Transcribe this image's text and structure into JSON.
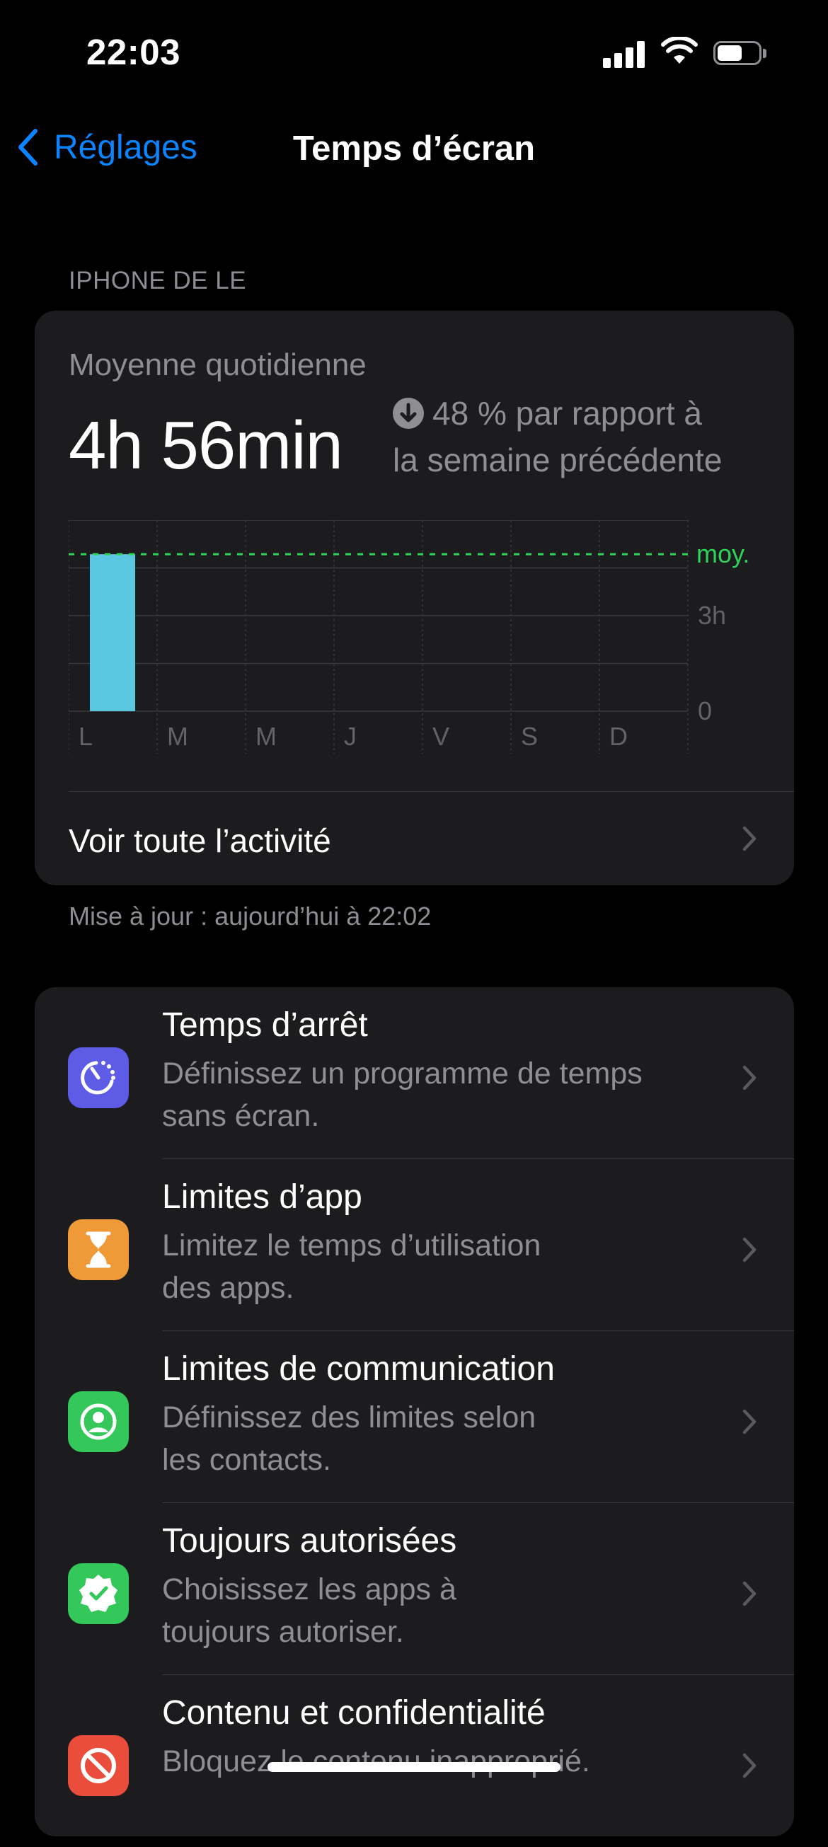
{
  "status": {
    "time": "22:03",
    "battery_level": 0.6
  },
  "nav": {
    "back_label": "Réglages",
    "title": "Temps d’écran"
  },
  "device_header": "IPHONE DE LE",
  "summary": {
    "avg_label": "Moyenne quotidienne",
    "avg_value": "4h 56min",
    "compare_line1": "48 % par rapport à",
    "compare_line2": "la semaine précédente",
    "see_all_label": "Voir toute l’activité"
  },
  "chart_data": {
    "type": "bar",
    "categories": [
      "L",
      "M",
      "M",
      "J",
      "V",
      "S",
      "D"
    ],
    "values": [
      4.93,
      0,
      0,
      0,
      0,
      0,
      0
    ],
    "average": 4.93,
    "average_label": "moy.",
    "y_ticks": [
      {
        "value": 0,
        "label": "0"
      },
      {
        "value": 3,
        "label": "3h"
      }
    ],
    "ylim": [
      0,
      6
    ],
    "colors": {
      "bar": "#5ac8e0",
      "average_line": "#30d158"
    }
  },
  "updated_text": "Mise à jour : aujourd’hui à 22:02",
  "settings": [
    {
      "title": "Temps d’arrêt",
      "sub1": "Définissez un programme de temps",
      "sub2": "sans écran.",
      "icon": "downtime-icon",
      "color": "#5e5ce6"
    },
    {
      "title": "Limites d’app",
      "sub1": "Limitez le temps d’utilisation",
      "sub2": "des apps.",
      "icon": "hourglass-icon",
      "color": "#f09a37"
    },
    {
      "title": "Limites de communication",
      "sub1": "Définissez des limites selon",
      "sub2": "les contacts.",
      "icon": "contact-icon",
      "color": "#34c759"
    },
    {
      "title": "Toujours autorisées",
      "sub1": "Choisissez les apps à",
      "sub2": "toujours autoriser.",
      "icon": "checkmark-badge-icon",
      "color": "#34c759"
    },
    {
      "title": "Contenu et confidentialité",
      "sub1": "Bloquez le contenu inapproprié.",
      "sub2": "",
      "icon": "restriction-icon",
      "color": "#eb4d3d"
    }
  ]
}
